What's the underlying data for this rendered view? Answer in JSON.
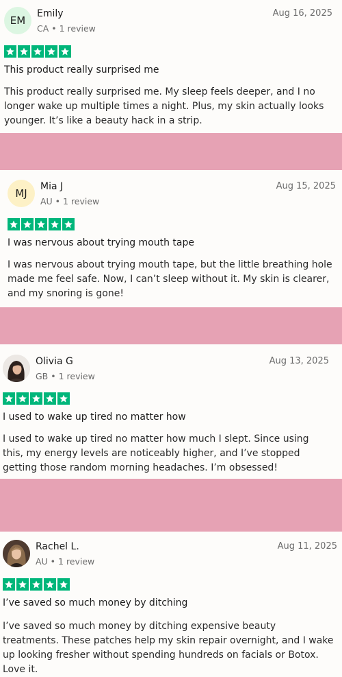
{
  "reviews": [
    {
      "initials": "EM",
      "avatar_color": "#dcf6e2",
      "name": "Emily",
      "meta": "CA • 1 review",
      "date": "Aug 16, 2025",
      "rating": 5,
      "title": "This product really surprised me",
      "body": "This product really surprised me. My sleep feels deeper, and I no longer wake up multiple times a night. Plus, my skin actually looks younger. It’s like a beauty hack in a strip."
    },
    {
      "initials": "MJ",
      "avatar_color": "#fdf1c6",
      "name": "Mia J",
      "meta": "AU • 1 review",
      "date": "Aug 15, 2025",
      "rating": 5,
      "title": "I was nervous about trying mouth tape",
      "body": "I was nervous about trying mouth tape, but the little breathing hole made me feel safe. Now, I can’t sleep without it. My skin is clearer, and my snoring is gone!"
    },
    {
      "initials": "",
      "avatar_color": "#3a2e2a",
      "name": "Olivia G",
      "meta": "GB • 1 review",
      "date": "Aug 13, 2025",
      "rating": 5,
      "title": "I used to wake up tired no matter how",
      "body": "I used to wake up tired no matter how much I slept. Since using this, my energy levels are noticeably higher, and I’ve stopped getting those random morning headaches. I’m obsessed!"
    },
    {
      "initials": "",
      "avatar_color": "#5a4535",
      "name": "Rachel L.",
      "meta": "AU • 1 review",
      "date": "Aug 11, 2025",
      "rating": 5,
      "title": "I’ve saved so much money by ditching",
      "body": "I’ve saved so much money by ditching expensive beauty treatments. These patches help my skin repair overnight, and I wake up looking fresher without spending hundreds on facials or Botox. Love it."
    }
  ],
  "colors": {
    "star_green": "#00b67a",
    "divider_pink": "#e6a2b4"
  }
}
